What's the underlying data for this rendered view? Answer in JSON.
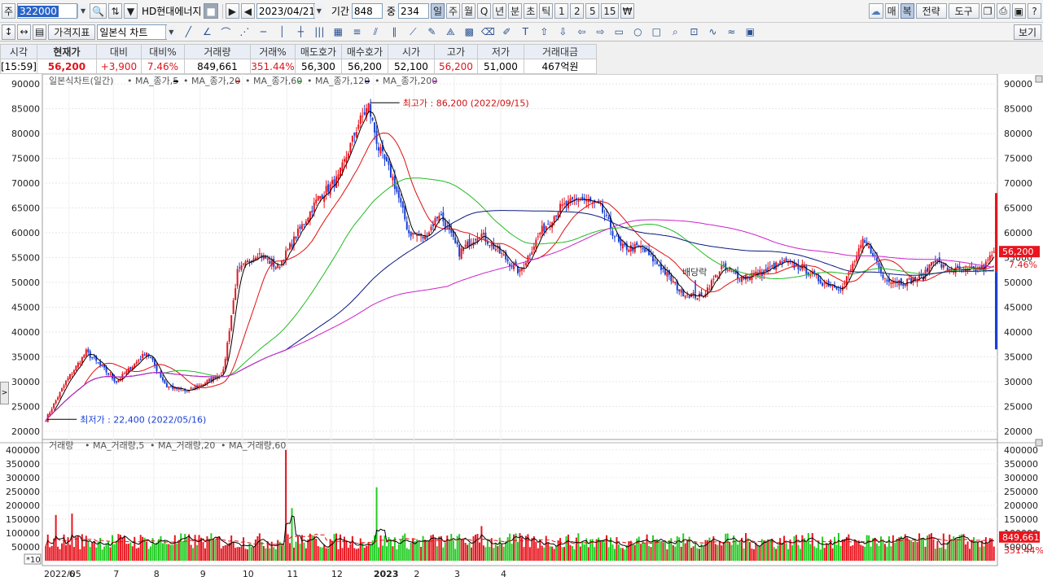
{
  "toolbar": {
    "market": "주",
    "code": "322000",
    "stock_name": "HD현대에너지",
    "date": "2023/04/21",
    "period_label": "기간",
    "period_value": "848",
    "count_label": "중",
    "count_value": "234",
    "period_buttons": [
      "일",
      "주",
      "월",
      "Q",
      "년",
      "분",
      "초",
      "틱",
      "1",
      "2",
      "5",
      "15"
    ],
    "selected_period": "일",
    "right_buttons": [
      "매",
      "복",
      "전략",
      "도구"
    ]
  },
  "toolbar2": {
    "indicator_btn": "가격지표",
    "chart_type": "일본식 차트",
    "view_btn": "보기"
  },
  "quote": {
    "headers": [
      "시각",
      "현재가",
      "대비",
      "대비%",
      "거래량",
      "거래%",
      "매도호가",
      "매수호가",
      "시가",
      "고가",
      "저가",
      "거래대금"
    ],
    "values": [
      "[15:59]",
      "56,200",
      "+3,900",
      "7.46%",
      "849,661",
      "351.44%",
      "56,300",
      "56,200",
      "52,100",
      "56,200",
      "51,000",
      "467억원"
    ]
  },
  "price_chart": {
    "legend_title": "일본식차트(일간)",
    "ma_labels": [
      "MA_종가,5",
      "MA_종가,20",
      "MA_종가,60",
      "MA_종가,120",
      "MA_종가,200"
    ],
    "high_annotation": "최고가 : 86,200 (2022/09/15)",
    "low_annotation": "최저가 : 22,400 (2022/05/16)",
    "event_annotation": "배당락",
    "current_price_tag": "56,200",
    "current_pct_tag": "7.46%"
  },
  "volume_chart": {
    "legend_title": "거래량",
    "ma_labels": [
      "MA_거래량,5",
      "MA_거래량,20",
      "MA_거래량,60"
    ],
    "current_volume_tag": "849,661",
    "current_pct_tag": "351.44%",
    "scale_tag": "*10"
  },
  "x_labels": [
    "2022/05",
    "6",
    "7",
    "8",
    "9",
    "10",
    "11",
    "12",
    "2023",
    "2",
    "3",
    "4"
  ],
  "chart_data": {
    "type": "candlestick",
    "y_ticks": [
      20000,
      25000,
      30000,
      35000,
      40000,
      45000,
      50000,
      55000,
      60000,
      65000,
      70000,
      75000,
      80000,
      85000,
      90000
    ],
    "ylim": [
      19000,
      91000
    ],
    "volume_ticks": [
      50000,
      100000,
      150000,
      200000,
      250000,
      300000,
      350000,
      400000
    ],
    "volume_ylim": [
      0,
      420000
    ],
    "high": {
      "value": 86200,
      "date": "2022/09/15"
    },
    "low": {
      "value": 22400,
      "date": "2022/05/16"
    },
    "waypoints": [
      [
        0,
        22400
      ],
      [
        10,
        30000
      ],
      [
        20,
        36000
      ],
      [
        35,
        30000
      ],
      [
        50,
        36000
      ],
      [
        60,
        29000
      ],
      [
        70,
        28000
      ],
      [
        80,
        30000
      ],
      [
        88,
        32000
      ],
      [
        95,
        52000
      ],
      [
        105,
        56000
      ],
      [
        115,
        53000
      ],
      [
        125,
        60000
      ],
      [
        135,
        67000
      ],
      [
        145,
        71000
      ],
      [
        155,
        82000
      ],
      [
        160,
        85500
      ],
      [
        165,
        77000
      ],
      [
        172,
        71000
      ],
      [
        180,
        60000
      ],
      [
        188,
        59000
      ],
      [
        195,
        64000
      ],
      [
        205,
        56000
      ],
      [
        215,
        60000
      ],
      [
        225,
        56000
      ],
      [
        235,
        52000
      ],
      [
        245,
        60000
      ],
      [
        255,
        65000
      ],
      [
        265,
        67000
      ],
      [
        275,
        65000
      ],
      [
        285,
        57000
      ],
      [
        295,
        57000
      ],
      [
        305,
        53000
      ],
      [
        315,
        48000
      ],
      [
        325,
        47000
      ],
      [
        335,
        53000
      ],
      [
        345,
        51000
      ],
      [
        355,
        52000
      ],
      [
        365,
        54000
      ],
      [
        375,
        53000
      ],
      [
        385,
        50000
      ],
      [
        395,
        49000
      ],
      [
        405,
        58000
      ],
      [
        410,
        56000
      ],
      [
        415,
        51000
      ],
      [
        425,
        50000
      ],
      [
        435,
        51000
      ],
      [
        440,
        55000
      ],
      [
        445,
        53000
      ],
      [
        455,
        52000
      ],
      [
        465,
        53000
      ],
      [
        470,
        56200
      ]
    ],
    "volume_spikes": [
      [
        5,
        165000
      ],
      [
        13,
        170000
      ],
      [
        119,
        400000
      ],
      [
        122,
        190000
      ],
      [
        164,
        265000
      ],
      [
        216,
        125000
      ],
      [
        378,
        100000
      ],
      [
        428,
        75000
      ],
      [
        466,
        85000
      ]
    ],
    "current": {
      "close": 56200,
      "volume": 849661
    }
  }
}
